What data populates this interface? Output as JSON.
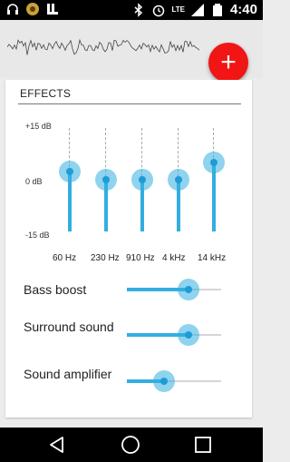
{
  "status_bar": {
    "time": "4:40",
    "network": "LTE",
    "icons": [
      "headphones-icon",
      "app-badge-icon",
      "notification-icon",
      "bluetooth-icon",
      "alarm-icon",
      "signal-icon",
      "battery-icon"
    ]
  },
  "header": {
    "add_label": "+"
  },
  "effects": {
    "title": "EFFECTS",
    "db_labels": {
      "top": "+15 dB",
      "mid": "0 dB",
      "bottom": "-15 dB"
    },
    "bands": [
      {
        "label": "60 Hz",
        "gain_db": 2.5
      },
      {
        "label": "230 Hz",
        "gain_db": 0
      },
      {
        "label": "910 Hz",
        "gain_db": 0
      },
      {
        "label": "4 kHz",
        "gain_db": 0
      },
      {
        "label": "14 kHz",
        "gain_db": 5
      }
    ],
    "sliders": [
      {
        "label": "Bass boost",
        "value": 0.65
      },
      {
        "label": "Surround sound",
        "value": 0.65
      },
      {
        "label": "Sound amplifier",
        "value": 0.39
      }
    ]
  },
  "colors": {
    "accent": "#33aee0",
    "fab": "#f21515"
  }
}
